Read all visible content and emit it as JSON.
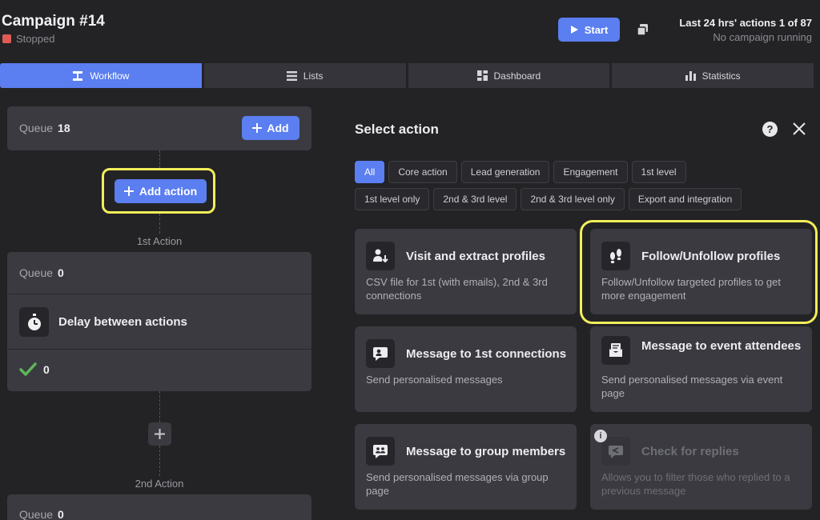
{
  "header": {
    "title": "Campaign #14",
    "status": "Stopped",
    "status_color": "#e05a55",
    "start_label": "Start",
    "summary_line1": "Last 24 hrs' actions 1 of 87",
    "summary_line2": "No campaign running"
  },
  "tabs": [
    {
      "label": "Workflow",
      "icon": "workflow-icon",
      "active": true
    },
    {
      "label": "Lists",
      "icon": "list-icon",
      "active": false
    },
    {
      "label": "Dashboard",
      "icon": "dashboard-icon",
      "active": false
    },
    {
      "label": "Statistics",
      "icon": "bar-chart-icon",
      "active": false
    }
  ],
  "workflow": {
    "queue_label": "Queue",
    "queue_count": "18",
    "add_label": "Add",
    "add_action_label": "Add action",
    "step1_label": "1st Action",
    "step1_queue_label": "Queue",
    "step1_queue_count": "0",
    "step1_action": "Delay between actions",
    "step1_done_count": "0",
    "step2_label": "2nd Action",
    "step2_queue_label": "Queue",
    "step2_queue_count": "0"
  },
  "select_action": {
    "title": "Select action",
    "help": "?",
    "filters": [
      "All",
      "Core action",
      "Lead generation",
      "Engagement",
      "1st level",
      "1st level only",
      "2nd & 3rd level",
      "2nd & 3rd level only",
      "Export and integration"
    ],
    "active_filter": "All",
    "cards": [
      {
        "title": "Visit and extract profiles",
        "desc": "CSV file for 1st (with emails), 2nd & 3rd connections",
        "icon": "download-user-icon"
      },
      {
        "title": "Follow/Unfollow profiles",
        "desc": "Follow/Unfollow targeted profiles to get more engagement",
        "icon": "footprints-icon"
      },
      {
        "title": "Message to 1st connections",
        "desc": "Send personalised messages",
        "icon": "chat-user-icon"
      },
      {
        "title": "Message to event attendees",
        "desc": "Send personalised messages via event page",
        "icon": "envelope-icon"
      },
      {
        "title": "Message to group members",
        "desc": "Send personalised messages via group page",
        "icon": "chat-group-icon"
      },
      {
        "title": "Check for replies",
        "desc": "Allows you to filter those who replied to a previous message",
        "icon": "reply-check-icon",
        "info": "i"
      }
    ]
  }
}
